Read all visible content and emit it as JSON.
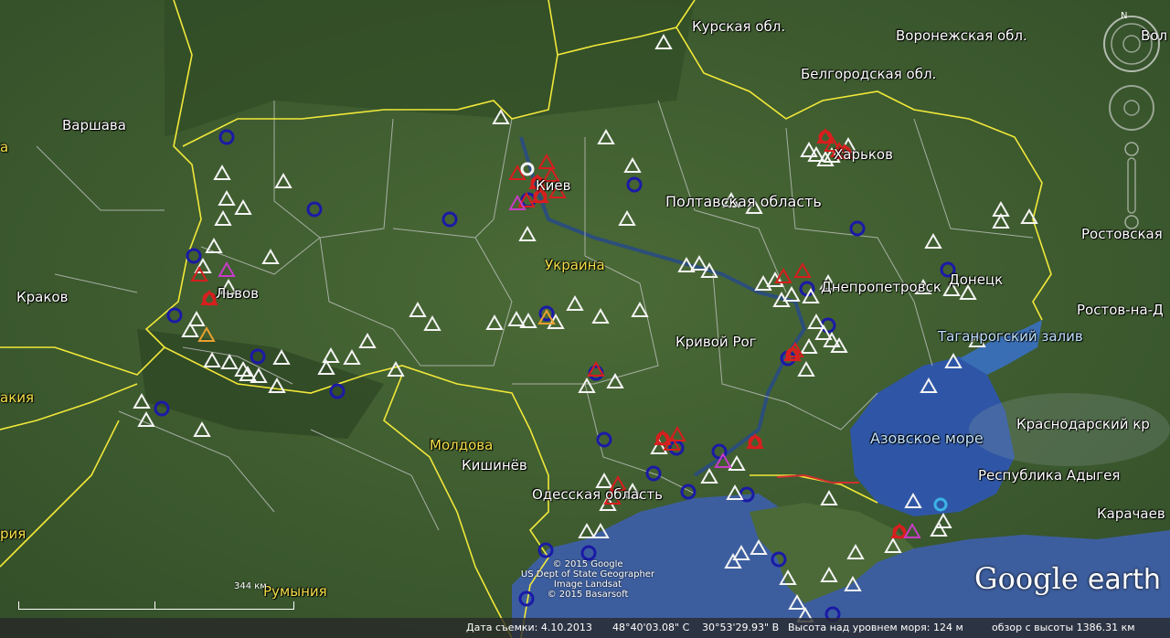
{
  "places": [
    {
      "name": "Курская обл.",
      "style": "w"
    },
    {
      "name": "Воронежская обл.",
      "style": "w"
    },
    {
      "name": "Вол",
      "style": "w"
    },
    {
      "name": "Белгородская обл.",
      "style": "w"
    },
    {
      "name": "Варшава",
      "style": "w"
    },
    {
      "name": "Киев",
      "style": "w"
    },
    {
      "name": "Харьков",
      "style": "w"
    },
    {
      "name": "Полтавская область",
      "style": "w"
    },
    {
      "name": "Ростовская",
      "style": "w"
    },
    {
      "name": "Украина",
      "style": "y"
    },
    {
      "name": "Краков",
      "style": "w"
    },
    {
      "name": "Львов",
      "style": "w"
    },
    {
      "name": "Днепропетровск",
      "style": "w"
    },
    {
      "name": "Донецк",
      "style": "w"
    },
    {
      "name": "Ростов-на-Д",
      "style": "w"
    },
    {
      "name": "Кривой Рог",
      "style": "w"
    },
    {
      "name": "Таганрогский залив",
      "style": "b"
    },
    {
      "name": "Краснодарский кр",
      "style": "w"
    },
    {
      "name": "Азовское море",
      "style": "b"
    },
    {
      "name": "Молдова",
      "style": "y"
    },
    {
      "name": "Кишинёв",
      "style": "w"
    },
    {
      "name": "Республика Адыгея",
      "style": "w"
    },
    {
      "name": "Одесская область",
      "style": "w"
    },
    {
      "name": "Карачаев",
      "style": "w"
    },
    {
      "name": "Румыния",
      "style": "y"
    },
    {
      "name": "акия",
      "style": "y"
    },
    {
      "name": "рия",
      "style": "y"
    },
    {
      "name": "а",
      "style": "y"
    }
  ],
  "attribution": [
    "© 2015 Google",
    "US Dept of State Geographer",
    "Image Landsat",
    "© 2015 Basarsoft"
  ],
  "scale_label": "344 км",
  "logo": {
    "google": "Google",
    "earth": "earth"
  },
  "compass_letter": "N",
  "status": {
    "date": "Дата съемки: 4.10.2013",
    "lat": "48°40'03.08\" С",
    "lon": "30°53'29.93\" В",
    "elevation": "Высота над уровнем моря:   124 м",
    "eye": "обзор с высоты 1386.31 км"
  },
  "marker_legend": {
    "white": "#f4f4f4",
    "red": "#d81e1e",
    "blue": "#1a1aa6",
    "magenta": "#c83cc8",
    "orange": "#e8a030",
    "cyan": "#3cb4e6"
  },
  "colors": {
    "border": "#f2e83a",
    "sea": "#3d5e9e",
    "land": "#3c5a2a",
    "front_line": "#d03030"
  }
}
